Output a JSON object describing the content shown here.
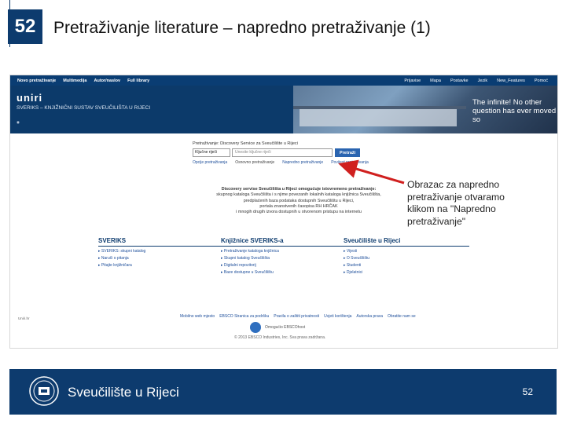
{
  "slide": {
    "number": "52",
    "title": "Pretraživanje literature – napredno pretraživanje (1)",
    "page_number": "52",
    "university_name": "Sveučilište u Rijeci"
  },
  "browser": {
    "nav_left": [
      "Novo pretraživanje",
      "Multimedija",
      "Autor/naslov",
      "Full library"
    ],
    "nav_right": [
      "Prijavise",
      "Mapa",
      "Postavke",
      "Jezik",
      "New_Features",
      "Pomoć"
    ]
  },
  "banner": {
    "logo_text": "uniri",
    "subtitle": "SVERIKS – KNJIŽNIČNI SUSTAV SVEUČILIŠTA U RIJECI",
    "quote": "The infinite! No other question has ever moved so"
  },
  "search": {
    "caption": "Pretraživanje: Discovery Service za Sveučilište u Rijeci",
    "select_value": "Ključne riječi",
    "placeholder": "Unesite ključne riječi",
    "button": "Pretraži",
    "links": [
      "Opcije pretraživanja",
      "Osnovno pretraživanje",
      "Napredno pretraživanje",
      "Povijest pretraživanja"
    ]
  },
  "intro": {
    "heading": "Discovery servise Sveučilišta u Rijeci omogućuje istovremeno pretraživanje:",
    "lines": [
      "skupnog kataloga Sveučilišta i s njime povezanih lokalnih kataloga knjižnica Sveučilišta,",
      "predplaćenih baza podataka dostupnih Sveučilištu u Rijeci,",
      "portala znanstvenih časopisa RH HRČAK",
      "i mnogih drugih izvora dostupnih u otvorenom pristupu na internetu"
    ]
  },
  "columns": [
    {
      "header": "SVERIKS",
      "items": [
        "SVERIKS: skupni katalog",
        "Naruči o pitanja",
        "Pitajte knjižničara"
      ]
    },
    {
      "header": "Knjižnice SVERIKS-a",
      "items": [
        "Pretraživanje kataloga knjižnica",
        "Skupni katalog Sveučilišta",
        "Digitalni repozitorij",
        "Baze dostupne u Sveučilištu"
      ]
    },
    {
      "header": "Sveučilište u Rijeci",
      "items": [
        "Vijesti",
        "O Sveučilištu",
        "Studenti",
        "Djelatnici"
      ]
    }
  ],
  "footer": {
    "left_text": "Uniri.hr",
    "links": [
      "Mobilno web mjesto",
      "EBSCO Stranica za podršku",
      "Pravila o zaštiti privatnosti",
      "Uvjeti korištenja",
      "Autorska prava",
      "Obratite nam se"
    ],
    "powered": "Omogućio EBSCOhost",
    "copyright": "© 2013 EBSCO Industries, Inc. Sva prava zadržana."
  },
  "callout": {
    "lines": [
      "Obrazac za napredno",
      "pretraživanje otvaramo",
      "klikom na \"Napredno",
      "pretraživanje\""
    ]
  },
  "colors": {
    "navy": "#0d3b6e",
    "arrow": "#d0201f",
    "link": "#1d4e9a"
  }
}
